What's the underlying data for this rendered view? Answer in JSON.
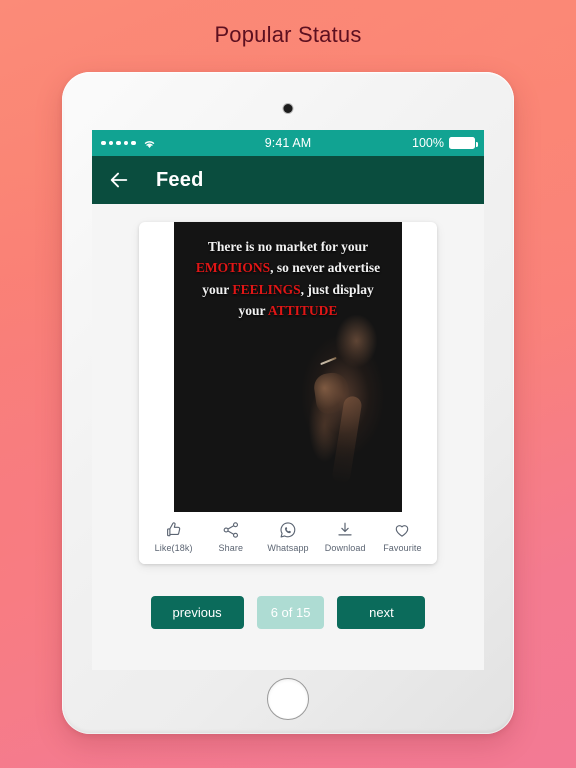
{
  "page": {
    "title": "Popular Status"
  },
  "theme": {
    "accent_teal": "#11a392",
    "appbar_green": "#0a4d3e",
    "button_green": "#0b6b5b",
    "count_badge": "#aedcd3",
    "background_start": "#fb8b78",
    "background_end": "#f37a94",
    "title_color": "#5d1020",
    "quote_highlight": "#e01616",
    "screen_background": "#f5f5f5"
  },
  "device": {
    "camera_icon": "camera-dot",
    "home_button_icon": "home-button"
  },
  "status_bar": {
    "signal_icon": "signal-dots-icon",
    "signal_dots": 5,
    "wifi_icon": "wifi-icon",
    "time": "9:41 AM",
    "battery_text": "100%",
    "battery_icon": "battery-full-icon"
  },
  "app_bar": {
    "back_icon": "back-arrow-icon",
    "title": "Feed"
  },
  "status_card": {
    "image": {
      "alt": "quote-image",
      "background_color": "#141414",
      "lines": [
        {
          "segments": [
            {
              "text": "There is no market for your",
              "highlight": false
            }
          ]
        },
        {
          "segments": [
            {
              "text": "EMOTIONS",
              "highlight": true
            },
            {
              "text": ", so never advertise",
              "highlight": false
            }
          ]
        },
        {
          "segments": [
            {
              "text": "your ",
              "highlight": false
            },
            {
              "text": "FEELINGS",
              "highlight": true
            },
            {
              "text": ", just display",
              "highlight": false
            }
          ]
        },
        {
          "segments": [
            {
              "text": "your ",
              "highlight": false
            },
            {
              "text": "ATTITUDE",
              "highlight": true
            }
          ]
        }
      ],
      "full_text": "There is no market for your EMOTIONS, so never advertise your FEELINGS, just display your ATTITUDE",
      "photo_subject": "silhouette of man smoking a cigarette"
    },
    "actions": [
      {
        "icon": "thumbs-up-icon",
        "label": "Like(18k)"
      },
      {
        "icon": "share-nodes-icon",
        "label": "Share"
      },
      {
        "icon": "whatsapp-icon",
        "label": "Whatsapp"
      },
      {
        "icon": "download-icon",
        "label": "Download"
      },
      {
        "icon": "heart-icon",
        "label": "Favourite"
      }
    ]
  },
  "pagination": {
    "previous_label": "previous",
    "counter_label": "6 of 15",
    "current_page": 6,
    "total_pages": 15,
    "next_label": "next"
  }
}
